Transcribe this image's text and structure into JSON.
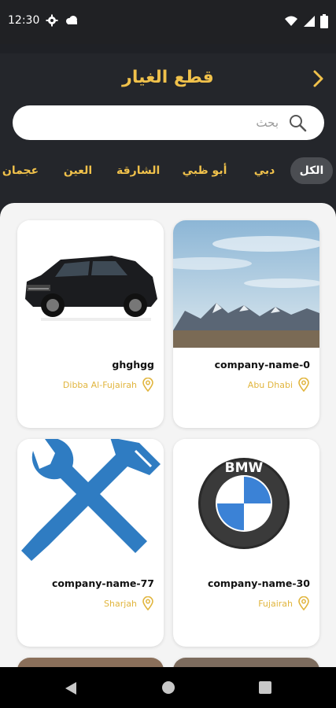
{
  "status_bar": {
    "time": "12:30",
    "left_icons": [
      "gear-icon",
      "cloud-icon"
    ],
    "right_icons": [
      "wifi-icon",
      "signal-icon",
      "battery-icon"
    ]
  },
  "header": {
    "title": "قطع الغيار",
    "back_icon": "chevron-right-icon"
  },
  "search": {
    "placeholder": "بحث"
  },
  "filters": [
    {
      "label": "الكل",
      "active": true
    },
    {
      "label": "دبي",
      "active": false
    },
    {
      "label": "أبو ظبي",
      "active": false
    },
    {
      "label": "الشارقة",
      "active": false
    },
    {
      "label": "العين",
      "active": false
    },
    {
      "label": "عجمان",
      "active": false
    }
  ],
  "cards": [
    {
      "name": "company-name-0",
      "location": "Abu Dhabi",
      "image": "mountain-landscape"
    },
    {
      "name": "ghghgg",
      "location": "Dibba Al-Fujairah",
      "image": "black-suv"
    },
    {
      "name": "company-name-30",
      "location": "Fujairah",
      "image": "bmw-logo"
    },
    {
      "name": "company-name-77",
      "location": "Sharjah",
      "image": "tools-icon"
    }
  ],
  "bmw_logo_text": "BMW",
  "colors": {
    "accent": "#f0c14b",
    "header_bg": "#24262b",
    "content_bg": "#f4f4f4",
    "chip_active_bg": "#4b4d52"
  },
  "nav_bar": {
    "icons": [
      "back-triangle-icon",
      "home-circle-icon",
      "recents-square-icon"
    ]
  }
}
